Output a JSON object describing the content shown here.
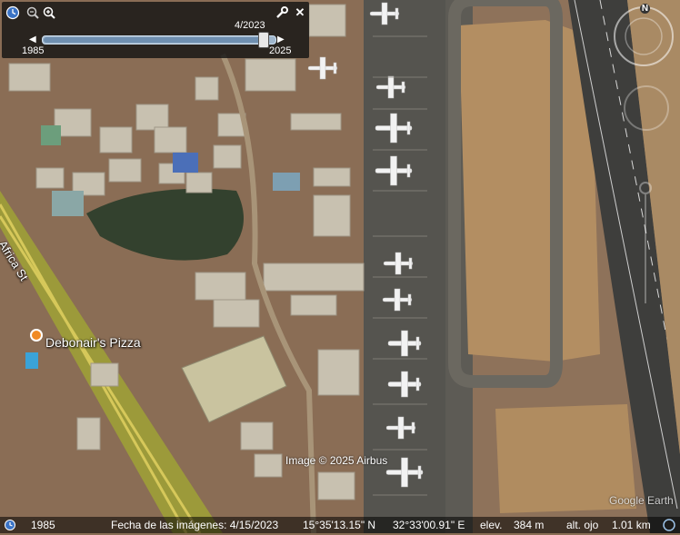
{
  "app": {
    "name": "Google Earth"
  },
  "toolbar": {
    "current_date_label": "4/2023",
    "range_start": "1985",
    "range_end": "2025",
    "slider_position": 0.95,
    "icons": [
      "clock-icon",
      "zoom-out-icon",
      "zoom-in-icon",
      "wrench-icon",
      "close-icon"
    ]
  },
  "map_labels": {
    "street": "Africa St",
    "poi": "Debonair's Pizza",
    "imagery_credit": "Image © 2025 Airbus",
    "logo": "Google Earth",
    "compass_north": "N"
  },
  "statusbar": {
    "historical_year": "1985",
    "imagery_date": "Fecha de las imágenes: 4/15/2023",
    "latitude": "15°35'13.15\" N",
    "longitude": "32°33'00.91\" E",
    "elevation_label": "elev.",
    "elevation_value": "384 m",
    "eye_alt_label": "alt. ojo",
    "eye_alt_value": "1.01 km"
  },
  "colors": {
    "runway": "#4a4a48",
    "sand": "#b58f63",
    "buildings": "#c6bfae",
    "toolbar_bg": "#141414",
    "slider": "#6f8fb0"
  }
}
